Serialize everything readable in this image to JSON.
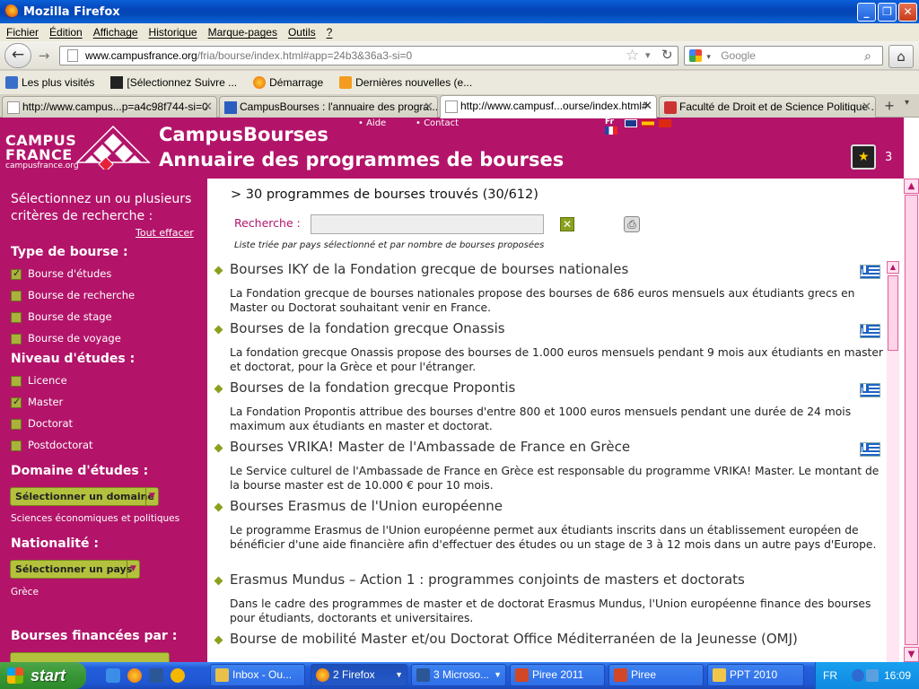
{
  "window": {
    "title": "Mozilla Firefox",
    "buttons": [
      "minimize",
      "maximize",
      "close"
    ]
  },
  "menu": [
    "Fichier",
    "Édition",
    "Affichage",
    "Historique",
    "Marque-pages",
    "Outils",
    "?"
  ],
  "nav": {
    "url_host": "www.campusfrance.org",
    "url_path": "/fria/bourse/index.html#app=24b3&36a3-si=0",
    "search_placeholder": "Google"
  },
  "bookmarks": [
    "Les plus visités",
    "[Sélectionnez Suivre ...",
    "Démarrage",
    "Dernières nouvelles (e..."
  ],
  "tabs": [
    {
      "label": "http://www.campus...p=a4c98f744-si=0",
      "active": false
    },
    {
      "label": "CampusBourses : l'annuaire des progra...",
      "active": false
    },
    {
      "label": "http://www.campusf...ourse/index.html#",
      "active": true
    },
    {
      "label": "Faculté de Droit et de Science Politique ...",
      "active": false
    }
  ],
  "header": {
    "logo_line1": "CAMPUS",
    "logo_line2": "FRANCE",
    "logo_url": "campusfrance.org",
    "title": "CampusBourses",
    "subtitle": "Annuaire des programmes de bourses",
    "link_aide": "Aide",
    "link_contact": "Contact",
    "lang_label": "Fr",
    "cart_count": "3"
  },
  "sidebar": {
    "intro": "Sélectionnez un ou plusieurs critères de recherche :",
    "clear_all": "Tout effacer",
    "type_heading": "Type de bourse :",
    "types": [
      {
        "label": "Bourse d'études",
        "checked": true
      },
      {
        "label": "Bourse de recherche",
        "checked": false
      },
      {
        "label": "Bourse de stage",
        "checked": false
      },
      {
        "label": "Bourse de voyage",
        "checked": false
      }
    ],
    "level_heading": "Niveau d'études :",
    "levels": [
      {
        "label": "Licence",
        "checked": false
      },
      {
        "label": "Master",
        "checked": true
      },
      {
        "label": "Doctorat",
        "checked": false
      },
      {
        "label": "Postdoctorat",
        "checked": false
      }
    ],
    "domain_heading": "Domaine d'études :",
    "domain_button": "Sélectionner un domaine",
    "domain_selected": "Sciences économiques et politiques",
    "nationality_heading": "Nationalité :",
    "nationality_button": "Sélectionner un pays",
    "nationality_selected": "Grèce",
    "financed_heading": "Bourses financées par :"
  },
  "results": {
    "summary": "> 30 programmes de bourses trouvés (30/612)",
    "search_label": "Recherche :",
    "search_value": "",
    "sort_note": "Liste triée par pays sélectionné et par nombre de bourses proposées",
    "items": [
      {
        "title": "Bourses IKY de la Fondation grecque de bourses nationales",
        "desc": "La Fondation grecque de bourses nationales propose des bourses de 686 euros mensuels aux étudiants grecs en Master ou Doctorat souhaitant venir en France.",
        "flag": "greece"
      },
      {
        "title": "Bourses de la fondation grecque Onassis",
        "desc": "La fondation grecque Onassis propose des bourses de 1.000 euros mensuels pendant 9 mois aux étudiants en master et doctorat, pour la Grèce et pour l'étranger.",
        "flag": "greece"
      },
      {
        "title": "Bourses de la fondation grecque Propontis",
        "desc": "La Fondation Propontis attribue des bourses d'entre 800 et 1000 euros mensuels pendant une durée de 24 mois maximum aux étudiants en master et doctorat.",
        "flag": "greece"
      },
      {
        "title": "Bourses VRIKA! Master de l'Ambassade de France en Grèce",
        "desc": "Le Service culturel de l'Ambassade de France en Grèce est responsable du programme VRIKA! Master. Le montant de la bourse master est de 10.000 € pour 10 mois.",
        "flag": "greece"
      },
      {
        "title": "Bourses Erasmus de l'Union européenne",
        "desc": "Le programme Erasmus de l'Union européenne permet aux étudiants inscrits dans un établissement européen de bénéficier d'une aide financière afin d'effectuer des études ou un stage de 3 à 12 mois dans un autre pays d'Europe.",
        "flag": ""
      },
      {
        "title": "Erasmus Mundus – Action 1 : programmes conjoints de masters et doctorats",
        "desc": "Dans le cadre des programmes de master et de doctorat Erasmus Mundus, l'Union européenne finance des bourses pour étudiants, doctorants et universitaires.",
        "flag": ""
      },
      {
        "title": "Bourse de mobilité Master et/ou Doctorat Office Méditerranéen de la Jeunesse (OMJ)",
        "desc": "",
        "flag": ""
      }
    ]
  },
  "taskbar": {
    "start": "start",
    "items": [
      {
        "label": "Inbox - Ou...",
        "active": false
      },
      {
        "label": "2 Firefox",
        "active": true
      },
      {
        "label": "3 Microso...",
        "active": false
      },
      {
        "label": "Piree 2011",
        "active": false
      },
      {
        "label": "Piree",
        "active": false
      },
      {
        "label": "PPT 2010",
        "active": false
      }
    ],
    "lang": "FR",
    "clock": "16:09"
  },
  "colors": {
    "brand": "#b3146a",
    "accent_green": "#8aa11d",
    "button_green": "#b4c13d"
  }
}
